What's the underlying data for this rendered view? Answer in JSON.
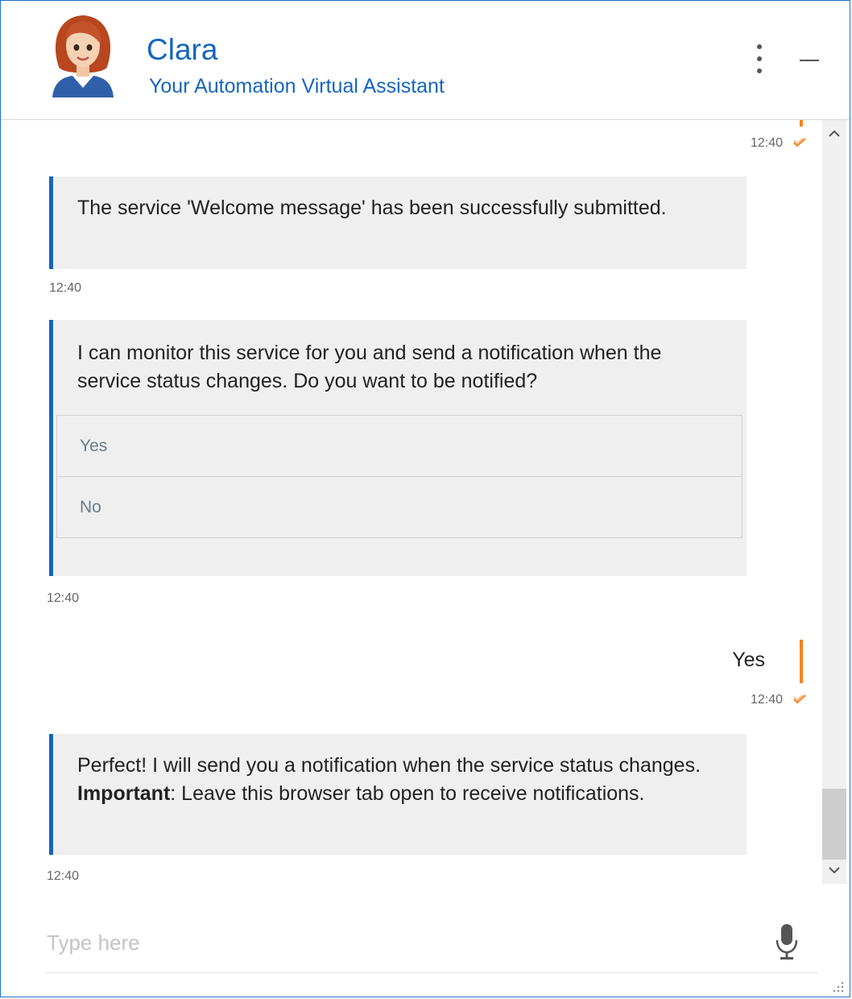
{
  "header": {
    "name": "Clara",
    "subtitle": "Your Automation Virtual Assistant"
  },
  "messages": [
    {
      "from": "user",
      "time": "12:40"
    },
    {
      "from": "bot",
      "text": "The service 'Welcome message' has been successfully submitted.",
      "time": "12:40"
    },
    {
      "from": "bot",
      "text": "I can monitor this service for you and send a notification when the service status changes. Do you want to be notified?",
      "options": [
        "Yes",
        "No"
      ],
      "time": "12:40"
    },
    {
      "from": "user",
      "text": "Yes",
      "time": "12:40"
    },
    {
      "from": "bot",
      "text": "Perfect! I will send you a notification when the service status changes.",
      "important_label": "Important",
      "important_text": ": Leave this browser tab open to receive notifications.",
      "time": "12:40"
    }
  ],
  "input": {
    "placeholder": "Type here"
  },
  "colors": {
    "brand": "#1565c0",
    "accent": "#f58220",
    "bubble": "#efefef"
  },
  "icons": [
    "avatar",
    "more-vertical-icon",
    "minimize-icon",
    "chevron-up-icon",
    "chevron-down-icon",
    "check-icon",
    "microphone-icon",
    "resize-grip-icon"
  ]
}
